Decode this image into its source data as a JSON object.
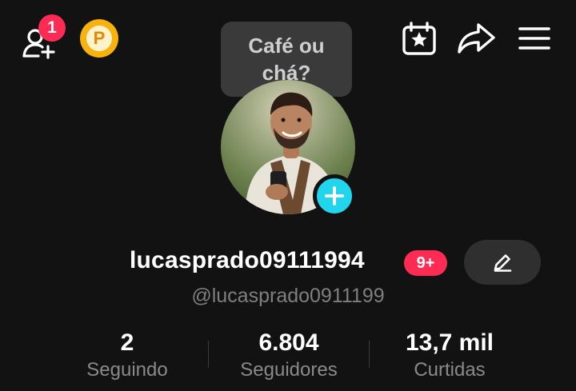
{
  "header": {
    "friend_requests_count": "1",
    "coin_label": "P"
  },
  "avatar_bubble": {
    "text": "Café ou chá?"
  },
  "profile": {
    "username": "lucasprado09111994",
    "notification_badge": "9+",
    "handle": "@lucasprado0911199"
  },
  "stats": [
    {
      "value": "2",
      "label": "Seguindo"
    },
    {
      "value": "6.804",
      "label": "Seguidores"
    },
    {
      "value": "13,7 mil",
      "label": "Curtidas"
    }
  ],
  "icons": {
    "add_friend": "add-friend-icon",
    "coin": "coin-icon",
    "calendar": "calendar-star-icon",
    "share": "share-icon",
    "menu": "menu-icon",
    "plus": "plus-icon",
    "edit": "pencil-icon"
  },
  "colors": {
    "background": "#121212",
    "badge_red": "#fe2c55",
    "plus_cyan": "#20d5ec",
    "coin_gold": "#f8b20c"
  }
}
